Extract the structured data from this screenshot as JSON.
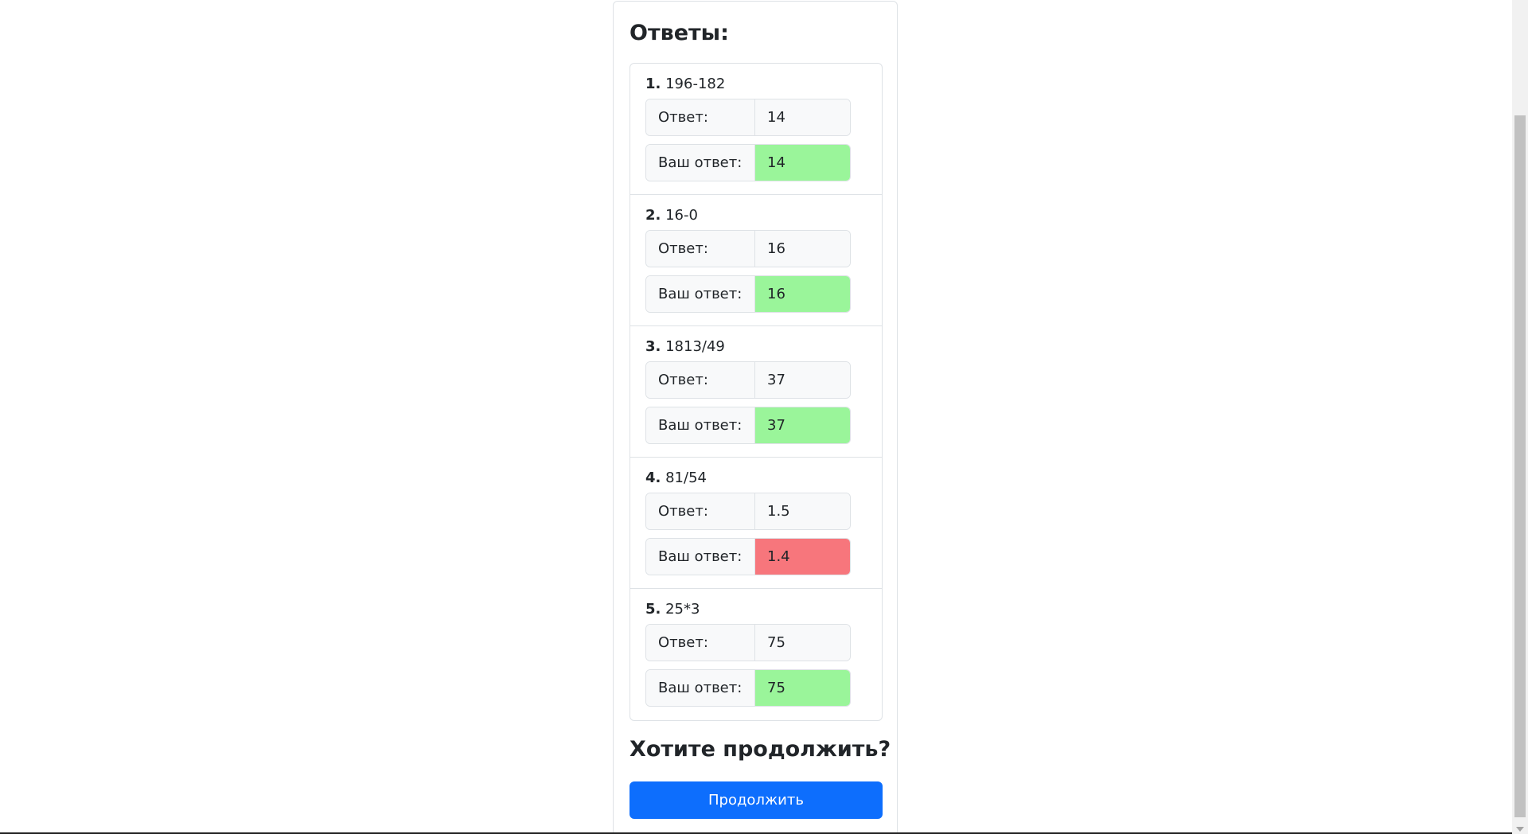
{
  "answers_title": "Ответы:",
  "items": [
    {
      "num": "1.",
      "question": "196-182",
      "answer_label": "Ответ:",
      "answer": "14",
      "your_label": "Ваш ответ:",
      "your_answer": "14",
      "status": "correct"
    },
    {
      "num": "2.",
      "question": "16-0",
      "answer_label": "Ответ:",
      "answer": "16",
      "your_label": "Ваш ответ:",
      "your_answer": "16",
      "status": "correct"
    },
    {
      "num": "3.",
      "question": "1813/49",
      "answer_label": "Ответ:",
      "answer": "37",
      "your_label": "Ваш ответ:",
      "your_answer": "37",
      "status": "correct"
    },
    {
      "num": "4.",
      "question": "81/54",
      "answer_label": "Ответ:",
      "answer": "1.5",
      "your_label": "Ваш ответ:",
      "your_answer": "1.4",
      "status": "wrong"
    },
    {
      "num": "5.",
      "question": "25*3",
      "answer_label": "Ответ:",
      "answer": "75",
      "your_label": "Ваш ответ:",
      "your_answer": "75",
      "status": "correct"
    }
  ],
  "continue_title": "Хотите продолжить?",
  "continue_button": "Продолжить",
  "colors": {
    "correct": "#9af59a",
    "wrong": "#f7767c",
    "primary": "#0d6efd"
  }
}
